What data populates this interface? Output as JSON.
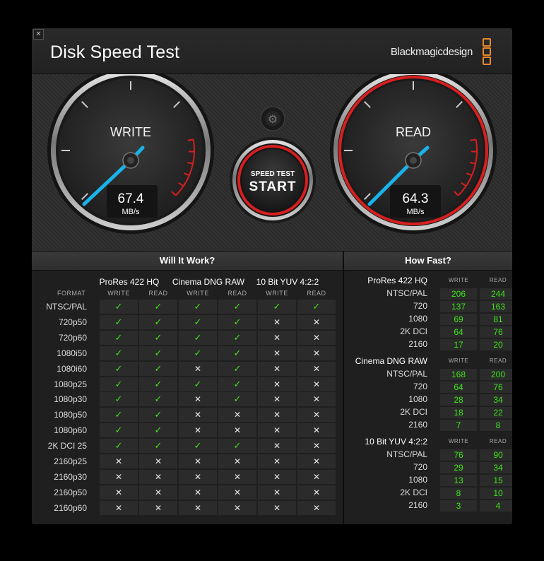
{
  "window": {
    "close_label": "✕",
    "title": "Disk Speed Test",
    "brand": "Blackmagicdesign",
    "colors": {
      "accent": "#d71f1f",
      "ok": "#3ee51a",
      "needle": "#19b3ea",
      "logo": "#e8892c"
    }
  },
  "gauges": {
    "write": {
      "label": "WRITE",
      "value": "67.4",
      "unit": "MB/s"
    },
    "read": {
      "label": "READ",
      "value": "64.3",
      "unit": "MB/s"
    },
    "settings_icon": "gear-icon",
    "start": {
      "line1": "SPEED TEST",
      "line2": "START"
    }
  },
  "will_it_work": {
    "title": "Will It Work?",
    "format_label": "FORMAT",
    "groups": [
      "ProRes 422 HQ",
      "Cinema DNG RAW",
      "10 Bit YUV 4:2:2"
    ],
    "sub_headers": [
      "WRITE",
      "READ"
    ],
    "rows": [
      {
        "format": "NTSC/PAL",
        "cells": [
          1,
          1,
          1,
          1,
          1,
          1
        ]
      },
      {
        "format": "720p50",
        "cells": [
          1,
          1,
          1,
          1,
          0,
          0
        ]
      },
      {
        "format": "720p60",
        "cells": [
          1,
          1,
          1,
          1,
          0,
          0
        ]
      },
      {
        "format": "1080i50",
        "cells": [
          1,
          1,
          1,
          1,
          0,
          0
        ]
      },
      {
        "format": "1080i60",
        "cells": [
          1,
          1,
          0,
          1,
          0,
          0
        ]
      },
      {
        "format": "1080p25",
        "cells": [
          1,
          1,
          1,
          1,
          0,
          0
        ]
      },
      {
        "format": "1080p30",
        "cells": [
          1,
          1,
          0,
          1,
          0,
          0
        ]
      },
      {
        "format": "1080p50",
        "cells": [
          1,
          1,
          0,
          0,
          0,
          0
        ]
      },
      {
        "format": "1080p60",
        "cells": [
          1,
          1,
          0,
          0,
          0,
          0
        ]
      },
      {
        "format": "2K DCI 25",
        "cells": [
          1,
          1,
          1,
          1,
          0,
          0
        ]
      },
      {
        "format": "2160p25",
        "cells": [
          0,
          0,
          0,
          0,
          0,
          0
        ]
      },
      {
        "format": "2160p30",
        "cells": [
          0,
          0,
          0,
          0,
          0,
          0
        ]
      },
      {
        "format": "2160p50",
        "cells": [
          0,
          0,
          0,
          0,
          0,
          0
        ]
      },
      {
        "format": "2160p60",
        "cells": [
          0,
          0,
          0,
          0,
          0,
          0
        ]
      }
    ],
    "check_glyph": "✓",
    "cross_glyph": "✕"
  },
  "how_fast": {
    "title": "How Fast?",
    "write_label": "WRITE",
    "read_label": "READ",
    "groups": [
      {
        "name": "ProRes 422 HQ",
        "rows": [
          {
            "label": "NTSC/PAL",
            "write": "206",
            "read": "244"
          },
          {
            "label": "720",
            "write": "137",
            "read": "163"
          },
          {
            "label": "1080",
            "write": "69",
            "read": "81"
          },
          {
            "label": "2K DCI",
            "write": "64",
            "read": "76"
          },
          {
            "label": "2160",
            "write": "17",
            "read": "20"
          }
        ]
      },
      {
        "name": "Cinema DNG RAW",
        "rows": [
          {
            "label": "NTSC/PAL",
            "write": "168",
            "read": "200"
          },
          {
            "label": "720",
            "write": "64",
            "read": "76"
          },
          {
            "label": "1080",
            "write": "28",
            "read": "34"
          },
          {
            "label": "2K DCI",
            "write": "18",
            "read": "22"
          },
          {
            "label": "2160",
            "write": "7",
            "read": "8"
          }
        ]
      },
      {
        "name": "10 Bit YUV 4:2:2",
        "rows": [
          {
            "label": "NTSC/PAL",
            "write": "76",
            "read": "90"
          },
          {
            "label": "720",
            "write": "29",
            "read": "34"
          },
          {
            "label": "1080",
            "write": "13",
            "read": "15"
          },
          {
            "label": "2K DCI",
            "write": "8",
            "read": "10"
          },
          {
            "label": "2160",
            "write": "3",
            "read": "4"
          }
        ]
      }
    ]
  }
}
